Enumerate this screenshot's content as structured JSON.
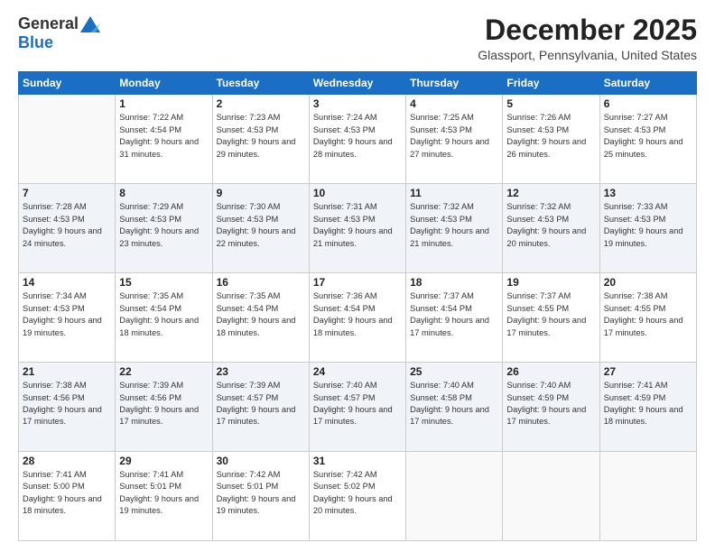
{
  "header": {
    "logo_general": "General",
    "logo_blue": "Blue",
    "month_title": "December 2025",
    "location": "Glassport, Pennsylvania, United States"
  },
  "weekdays": [
    "Sunday",
    "Monday",
    "Tuesday",
    "Wednesday",
    "Thursday",
    "Friday",
    "Saturday"
  ],
  "weeks": [
    [
      {
        "day": "",
        "sunrise": "",
        "sunset": "",
        "daylight": ""
      },
      {
        "day": "1",
        "sunrise": "Sunrise: 7:22 AM",
        "sunset": "Sunset: 4:54 PM",
        "daylight": "Daylight: 9 hours and 31 minutes."
      },
      {
        "day": "2",
        "sunrise": "Sunrise: 7:23 AM",
        "sunset": "Sunset: 4:53 PM",
        "daylight": "Daylight: 9 hours and 29 minutes."
      },
      {
        "day": "3",
        "sunrise": "Sunrise: 7:24 AM",
        "sunset": "Sunset: 4:53 PM",
        "daylight": "Daylight: 9 hours and 28 minutes."
      },
      {
        "day": "4",
        "sunrise": "Sunrise: 7:25 AM",
        "sunset": "Sunset: 4:53 PM",
        "daylight": "Daylight: 9 hours and 27 minutes."
      },
      {
        "day": "5",
        "sunrise": "Sunrise: 7:26 AM",
        "sunset": "Sunset: 4:53 PM",
        "daylight": "Daylight: 9 hours and 26 minutes."
      },
      {
        "day": "6",
        "sunrise": "Sunrise: 7:27 AM",
        "sunset": "Sunset: 4:53 PM",
        "daylight": "Daylight: 9 hours and 25 minutes."
      }
    ],
    [
      {
        "day": "7",
        "sunrise": "Sunrise: 7:28 AM",
        "sunset": "Sunset: 4:53 PM",
        "daylight": "Daylight: 9 hours and 24 minutes."
      },
      {
        "day": "8",
        "sunrise": "Sunrise: 7:29 AM",
        "sunset": "Sunset: 4:53 PM",
        "daylight": "Daylight: 9 hours and 23 minutes."
      },
      {
        "day": "9",
        "sunrise": "Sunrise: 7:30 AM",
        "sunset": "Sunset: 4:53 PM",
        "daylight": "Daylight: 9 hours and 22 minutes."
      },
      {
        "day": "10",
        "sunrise": "Sunrise: 7:31 AM",
        "sunset": "Sunset: 4:53 PM",
        "daylight": "Daylight: 9 hours and 21 minutes."
      },
      {
        "day": "11",
        "sunrise": "Sunrise: 7:32 AM",
        "sunset": "Sunset: 4:53 PM",
        "daylight": "Daylight: 9 hours and 21 minutes."
      },
      {
        "day": "12",
        "sunrise": "Sunrise: 7:32 AM",
        "sunset": "Sunset: 4:53 PM",
        "daylight": "Daylight: 9 hours and 20 minutes."
      },
      {
        "day": "13",
        "sunrise": "Sunrise: 7:33 AM",
        "sunset": "Sunset: 4:53 PM",
        "daylight": "Daylight: 9 hours and 19 minutes."
      }
    ],
    [
      {
        "day": "14",
        "sunrise": "Sunrise: 7:34 AM",
        "sunset": "Sunset: 4:53 PM",
        "daylight": "Daylight: 9 hours and 19 minutes."
      },
      {
        "day": "15",
        "sunrise": "Sunrise: 7:35 AM",
        "sunset": "Sunset: 4:54 PM",
        "daylight": "Daylight: 9 hours and 18 minutes."
      },
      {
        "day": "16",
        "sunrise": "Sunrise: 7:35 AM",
        "sunset": "Sunset: 4:54 PM",
        "daylight": "Daylight: 9 hours and 18 minutes."
      },
      {
        "day": "17",
        "sunrise": "Sunrise: 7:36 AM",
        "sunset": "Sunset: 4:54 PM",
        "daylight": "Daylight: 9 hours and 18 minutes."
      },
      {
        "day": "18",
        "sunrise": "Sunrise: 7:37 AM",
        "sunset": "Sunset: 4:54 PM",
        "daylight": "Daylight: 9 hours and 17 minutes."
      },
      {
        "day": "19",
        "sunrise": "Sunrise: 7:37 AM",
        "sunset": "Sunset: 4:55 PM",
        "daylight": "Daylight: 9 hours and 17 minutes."
      },
      {
        "day": "20",
        "sunrise": "Sunrise: 7:38 AM",
        "sunset": "Sunset: 4:55 PM",
        "daylight": "Daylight: 9 hours and 17 minutes."
      }
    ],
    [
      {
        "day": "21",
        "sunrise": "Sunrise: 7:38 AM",
        "sunset": "Sunset: 4:56 PM",
        "daylight": "Daylight: 9 hours and 17 minutes."
      },
      {
        "day": "22",
        "sunrise": "Sunrise: 7:39 AM",
        "sunset": "Sunset: 4:56 PM",
        "daylight": "Daylight: 9 hours and 17 minutes."
      },
      {
        "day": "23",
        "sunrise": "Sunrise: 7:39 AM",
        "sunset": "Sunset: 4:57 PM",
        "daylight": "Daylight: 9 hours and 17 minutes."
      },
      {
        "day": "24",
        "sunrise": "Sunrise: 7:40 AM",
        "sunset": "Sunset: 4:57 PM",
        "daylight": "Daylight: 9 hours and 17 minutes."
      },
      {
        "day": "25",
        "sunrise": "Sunrise: 7:40 AM",
        "sunset": "Sunset: 4:58 PM",
        "daylight": "Daylight: 9 hours and 17 minutes."
      },
      {
        "day": "26",
        "sunrise": "Sunrise: 7:40 AM",
        "sunset": "Sunset: 4:59 PM",
        "daylight": "Daylight: 9 hours and 17 minutes."
      },
      {
        "day": "27",
        "sunrise": "Sunrise: 7:41 AM",
        "sunset": "Sunset: 4:59 PM",
        "daylight": "Daylight: 9 hours and 18 minutes."
      }
    ],
    [
      {
        "day": "28",
        "sunrise": "Sunrise: 7:41 AM",
        "sunset": "Sunset: 5:00 PM",
        "daylight": "Daylight: 9 hours and 18 minutes."
      },
      {
        "day": "29",
        "sunrise": "Sunrise: 7:41 AM",
        "sunset": "Sunset: 5:01 PM",
        "daylight": "Daylight: 9 hours and 19 minutes."
      },
      {
        "day": "30",
        "sunrise": "Sunrise: 7:42 AM",
        "sunset": "Sunset: 5:01 PM",
        "daylight": "Daylight: 9 hours and 19 minutes."
      },
      {
        "day": "31",
        "sunrise": "Sunrise: 7:42 AM",
        "sunset": "Sunset: 5:02 PM",
        "daylight": "Daylight: 9 hours and 20 minutes."
      },
      {
        "day": "",
        "sunrise": "",
        "sunset": "",
        "daylight": ""
      },
      {
        "day": "",
        "sunrise": "",
        "sunset": "",
        "daylight": ""
      },
      {
        "day": "",
        "sunrise": "",
        "sunset": "",
        "daylight": ""
      }
    ]
  ]
}
